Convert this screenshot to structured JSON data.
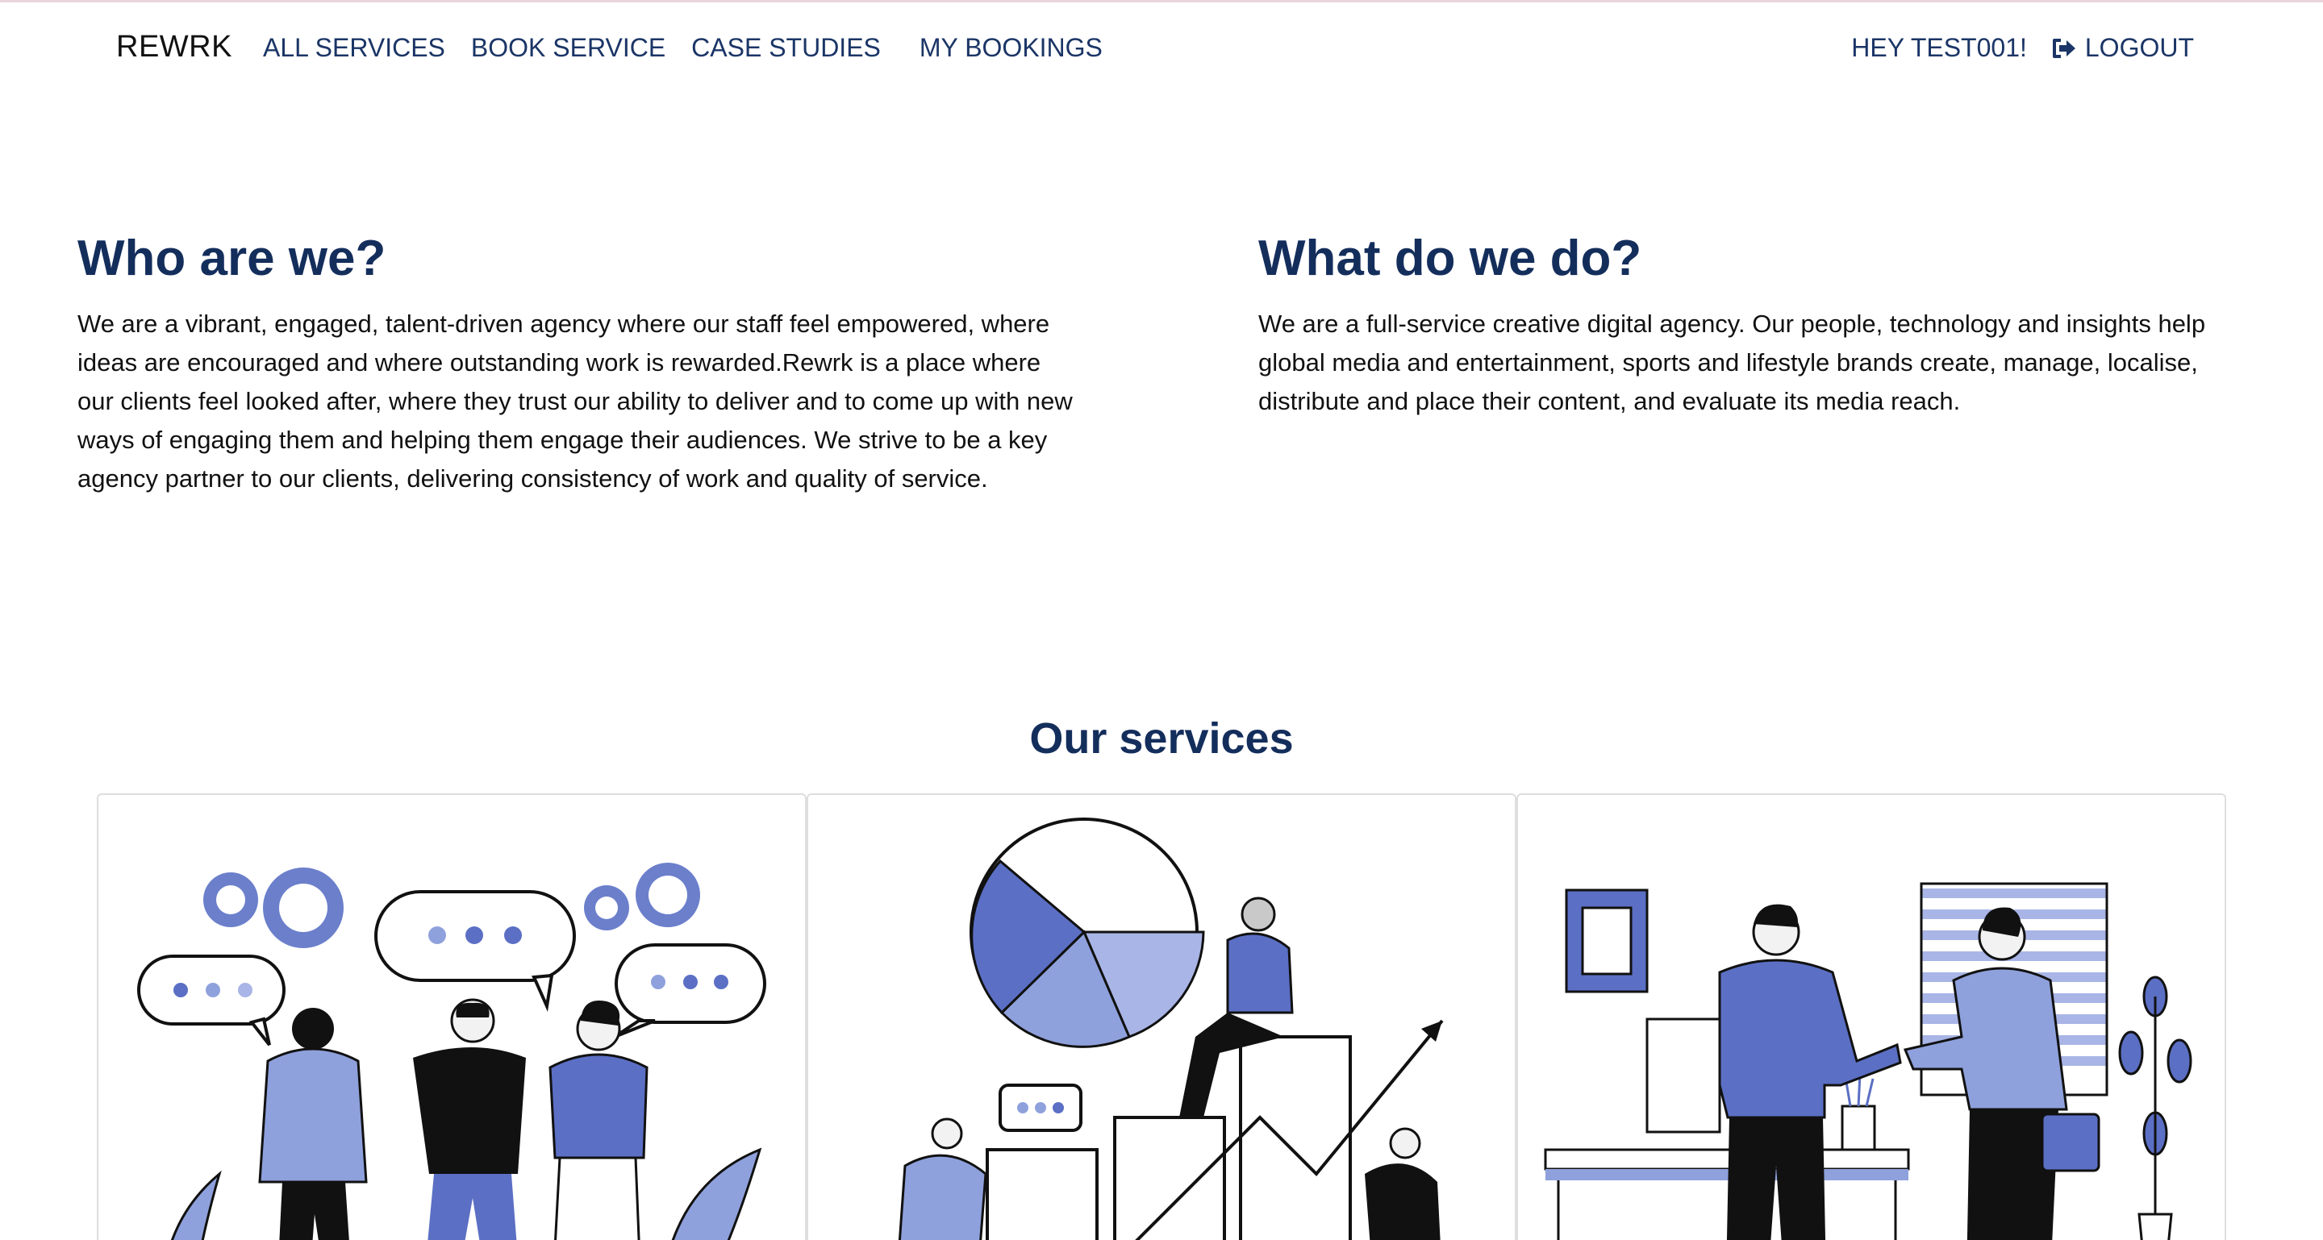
{
  "nav": {
    "brand": "REWRK",
    "links": [
      "ALL SERVICES",
      "BOOK SERVICE",
      "CASE STUDIES",
      "MY BOOKINGS"
    ],
    "greeting": "HEY TEST001!",
    "logout_label": "LOGOUT",
    "logout_icon": "sign-out-icon"
  },
  "about": {
    "who_title": "Who are we?",
    "who_text": "We are a vibrant, engaged, talent-driven agency where our staff feel empowered, where ideas are encouraged and where outstanding work is rewarded.Rewrk is a place where our clients feel looked after, where they trust our ability to deliver and to come up with new ways of engaging them and helping them engage their audiences. We strive to be a key agency partner to our clients, delivering consistency of work and quality of service.",
    "what_title": "What do we do?",
    "what_text": "We are a full-service creative digital agency. Our people, technology and insights help global media and entertainment, sports and lifestyle brands create, manage, localise, distribute and place their content, and evaluate its media reach."
  },
  "services": {
    "title": "Our services",
    "cards": [
      {
        "illustration": "team-discussion-illustration"
      },
      {
        "illustration": "analytics-chart-illustration"
      },
      {
        "illustration": "business-handshake-illustration"
      }
    ]
  },
  "colors": {
    "accent_blue": "#5b6fc4",
    "light_blue": "#8fa1dc",
    "heading_navy": "#142e5c",
    "nav_navy": "#1b3566"
  }
}
